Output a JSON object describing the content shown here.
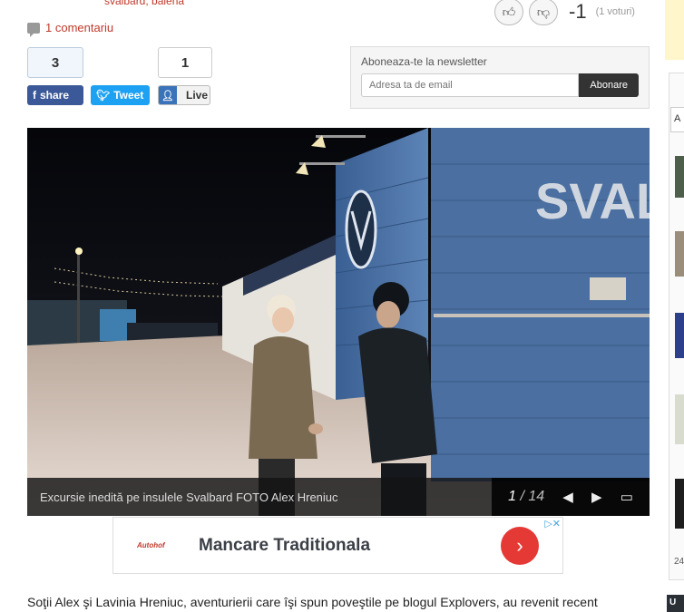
{
  "article_meta": {
    "tags": "svalbard, balena",
    "comments_label": "1 comentariu"
  },
  "votes": {
    "score": "-1",
    "count_label": "(1 voturi)"
  },
  "social": {
    "facebook_count": "3",
    "facebook_label": "share",
    "twitter_label": "Tweet",
    "live_count": "1",
    "live_label": "Live"
  },
  "newsletter": {
    "title": "Aboneaza-te la newsletter",
    "placeholder": "Adresa ta de email",
    "button_label": "Abonare"
  },
  "gallery": {
    "caption": "Excursie inedită pe insulele Svalbard FOTO Alex Hreniuc",
    "current": "1",
    "separator": "/",
    "total": "14",
    "sign_text": "SVAL"
  },
  "ad": {
    "logo_text": "Autohof",
    "title": "Mancare Traditionala"
  },
  "article": {
    "first_line": "Soţii Alex şi Lavinia Hreniuc, aventurierii care îşi spun poveştile pe blogul Explovers, au revenit recent"
  },
  "right_rail": {
    "tab_label": "A",
    "number": "24",
    "badge": "U"
  },
  "colors": {
    "accent_red": "#c0392b",
    "facebook": "#3b5998",
    "twitter": "#1da1f2",
    "live": "#3b73b9",
    "wall_blue": "#4a6fa0"
  }
}
